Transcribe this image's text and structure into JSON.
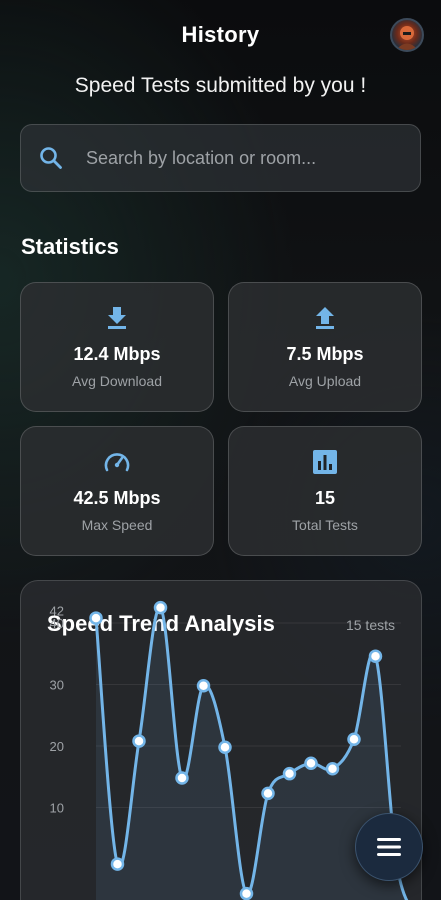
{
  "header": {
    "title": "History"
  },
  "subtitle": "Speed Tests submitted by you !",
  "search": {
    "placeholder": "Search by location or room..."
  },
  "statistics": {
    "title": "Statistics",
    "cards": [
      {
        "value": "12.4 Mbps",
        "label": "Avg Download",
        "icon": "download-icon"
      },
      {
        "value": "7.5 Mbps",
        "label": "Avg Upload",
        "icon": "upload-icon"
      },
      {
        "value": "42.5 Mbps",
        "label": "Max Speed",
        "icon": "speedometer-icon"
      },
      {
        "value": "15",
        "label": "Total Tests",
        "icon": "bar-chart-icon"
      }
    ]
  },
  "trend": {
    "title": "Speed Trend Analysis",
    "count_label": "15 tests"
  },
  "colors": {
    "accent": "#73b5e8",
    "card": "#2c2e31",
    "fab": "#1b2a3e"
  },
  "chart_data": {
    "type": "line",
    "title": "Speed Trend Analysis",
    "xlabel": "",
    "ylabel": "",
    "y_ticks": [
      10,
      20,
      30,
      40,
      42
    ],
    "ylim": [
      0,
      42
    ],
    "grid": true,
    "x": [
      1,
      2,
      3,
      4,
      5,
      6,
      7,
      8,
      9,
      10,
      11,
      12,
      13,
      14,
      15,
      16
    ],
    "values": [
      40.8,
      0.8,
      20.8,
      42.5,
      14.8,
      29.8,
      19.8,
      -4,
      12.3,
      15.5,
      17.2,
      16.3,
      21.1,
      34.6,
      0.6,
      -8
    ]
  }
}
